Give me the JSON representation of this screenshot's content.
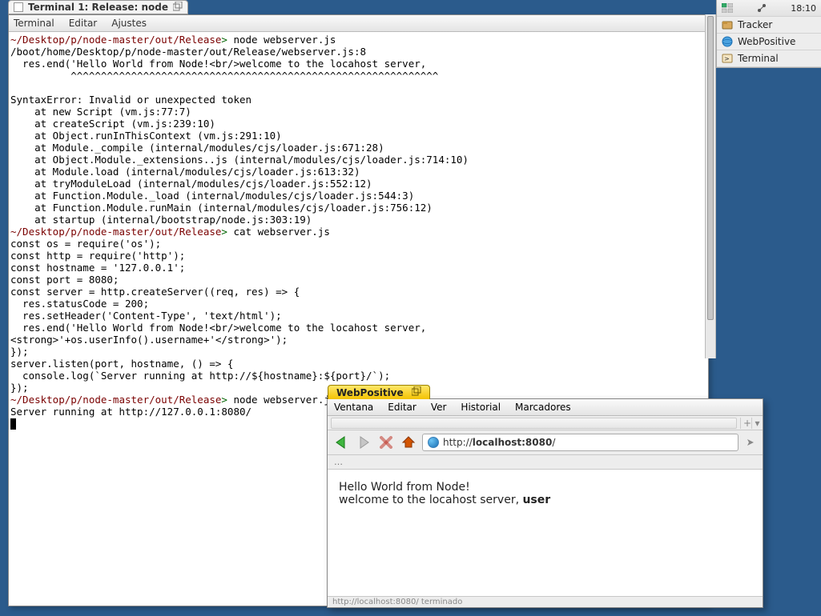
{
  "terminal": {
    "tab_title": "Terminal 1: Release: node",
    "menu": [
      "Terminal",
      "Editar",
      "Ajustes"
    ],
    "prompt": "~/Desktop/p/node-master/out/Release",
    "gt": ">",
    "cmd1": "node webserver.js",
    "err1": "/boot/home/Desktop/p/node-master/out/Release/webserver.js:8",
    "err2": "  res.end('Hello World from Node!<br/>welcome to the locahost server,",
    "err3": "          ^^^^^^^^^^^^^^^^^^^^^^^^^^^^^^^^^^^^^^^^^^^^^^^^^^^^^^^^^^^^^",
    "err4": "SyntaxError: Invalid or unexpected token",
    "stack": [
      "    at new Script (vm.js:77:7)",
      "    at createScript (vm.js:239:10)",
      "    at Object.runInThisContext (vm.js:291:10)",
      "    at Module._compile (internal/modules/cjs/loader.js:671:28)",
      "    at Object.Module._extensions..js (internal/modules/cjs/loader.js:714:10)",
      "    at Module.load (internal/modules/cjs/loader.js:613:32)",
      "    at tryModuleLoad (internal/modules/cjs/loader.js:552:12)",
      "    at Function.Module._load (internal/modules/cjs/loader.js:544:3)",
      "    at Function.Module.runMain (internal/modules/cjs/loader.js:756:12)",
      "    at startup (internal/bootstrap/node.js:303:19)"
    ],
    "cmd2": "cat webserver.js",
    "code": [
      "const os = require('os');",
      "const http = require('http');",
      "const hostname = '127.0.0.1';",
      "const port = 8080;",
      "const server = http.createServer((req, res) => {",
      "  res.statusCode = 200;",
      "  res.setHeader('Content-Type', 'text/html');",
      "  res.end('Hello World from Node!<br/>welcome to the locahost server,",
      "<strong>'+os.userInfo().username+'</strong>');",
      "});",
      "server.listen(port, hostname, () => {",
      "  console.log(`Server running at http://${hostname}:${port}/`);",
      "});"
    ],
    "cmd3": "node webserver.js",
    "out3": "Server running at http://127.0.0.1:8080/"
  },
  "deskbar": {
    "clock": "18:10",
    "apps": [
      {
        "name": "Tracker",
        "icon": "🗂"
      },
      {
        "name": "WebPositive",
        "icon": "🌐"
      },
      {
        "name": "Terminal",
        "icon": "🖳"
      }
    ]
  },
  "webp": {
    "tab_title": "WebPositive",
    "menu": [
      "Ventana",
      "Editar",
      "Ver",
      "Historial",
      "Marcadores"
    ],
    "url_prefix": "http://",
    "url_bold": "localhost:8080",
    "url_suffix": "/",
    "status_top": "…",
    "content_line1": "Hello World from Node!",
    "content_line2_a": "welcome to the locahost server, ",
    "content_line2_b": "user",
    "footer": "http://localhost:8080/ terminado"
  }
}
